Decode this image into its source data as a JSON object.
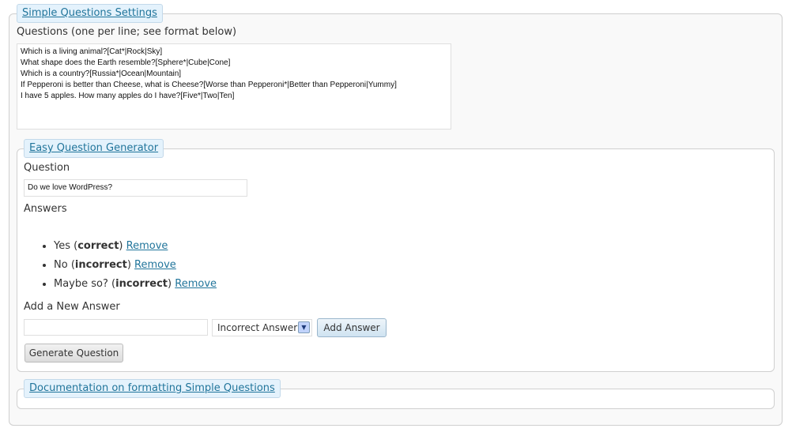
{
  "settings": {
    "legend": "Simple Questions Settings",
    "questions_label": "Questions (one per line; see format below)",
    "questions_text": "Which is a living animal?[Cat*|Rock|Sky]\nWhat shape does the Earth resemble?[Sphere*|Cube|Cone]\nWhich is a country?[Russia*|Ocean|Mountain]\nIf Pepperoni is better than Cheese, what is Cheese?[Worse than Pepperoni*|Better than Pepperoni|Yummy]\nI have 5 apples. How many apples do I have?[Five*|Two|Ten]"
  },
  "generator": {
    "legend": "Easy Question Generator",
    "question_label": "Question",
    "question_value": "Do we love WordPress?",
    "answers_label": "Answers",
    "answers": [
      {
        "text": "Yes",
        "status": "correct",
        "remove": "Remove"
      },
      {
        "text": "No",
        "status": "incorrect",
        "remove": "Remove"
      },
      {
        "text": "Maybe so?",
        "status": "incorrect",
        "remove": "Remove"
      }
    ],
    "new_answer_label": "Add a New Answer",
    "new_answer_value": "",
    "answer_type_selected": "Incorrect Answer",
    "add_answer_button": "Add Answer",
    "generate_button": "Generate Question"
  },
  "documentation": {
    "legend": "Documentation on formatting Simple Questions"
  },
  "colors": {
    "link": "#21759b",
    "legend_bg": "#e4f2fc"
  }
}
